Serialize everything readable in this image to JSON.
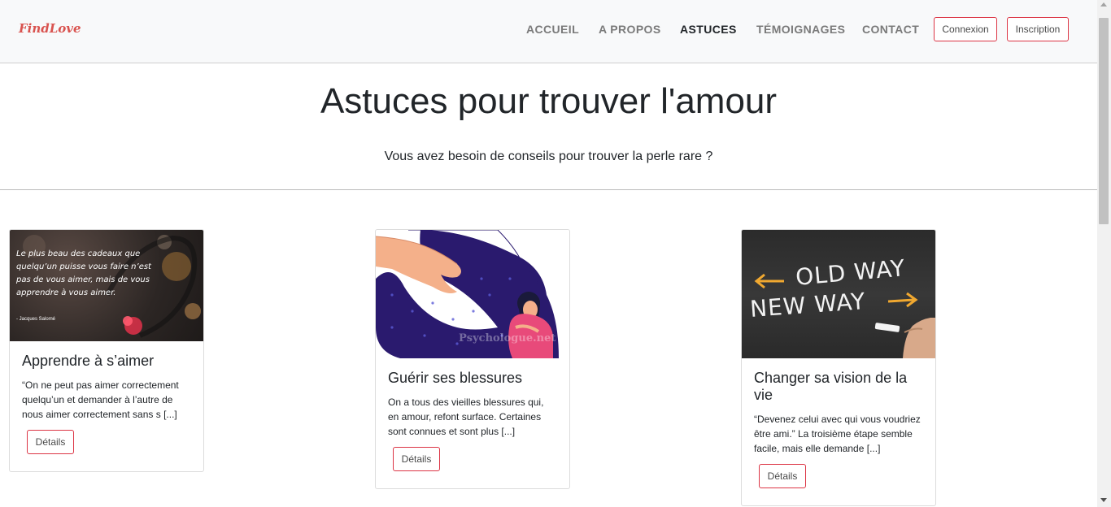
{
  "nav": {
    "brand": "FindLove",
    "links": [
      {
        "label": "ACCUEIL"
      },
      {
        "label": "A PROPOS"
      },
      {
        "label": "ASTUCES"
      },
      {
        "label": "TÉMOIGNAGES"
      },
      {
        "label": "CONTACT"
      }
    ],
    "login_label": "Connexion",
    "signup_label": "Inscription"
  },
  "hero": {
    "title": "Astuces pour trouver l'amour",
    "subtitle": "Vous avez besoin de conseils pour trouver la perle rare ?"
  },
  "cards": [
    {
      "title": "Apprendre à s’aimer",
      "text": "“On ne peut pas aimer correctement quelqu’un et demander à l’autre de nous aimer correctement sans s [...]",
      "button": "Détails",
      "image_quote": "Le plus beau des cadeaux que quelqu’un puisse vous faire n’est pas de vous aimer, mais de vous apprendre à vous aimer.",
      "image_author": "- Jacques Salomé"
    },
    {
      "title": "Guérir ses blessures",
      "text": "On a tous des vieilles blessures qui, en amour, refont surface. Certaines sont connues et sont plus [...]",
      "button": "Détails",
      "image_watermark": "Psychologue.net"
    },
    {
      "title": "Changer sa vision de la vie",
      "text": "“Devenez celui avec qui vous voudriez être ami.” La troisième étape semble facile, mais elle demande [...]",
      "button": "Détails",
      "image_line1": "OLD WAY",
      "image_line2": "NEW WAY"
    }
  ],
  "colors": {
    "accent": "#dc3545",
    "brand": "#d9534f",
    "navbar_bg": "#f8f9fa"
  }
}
